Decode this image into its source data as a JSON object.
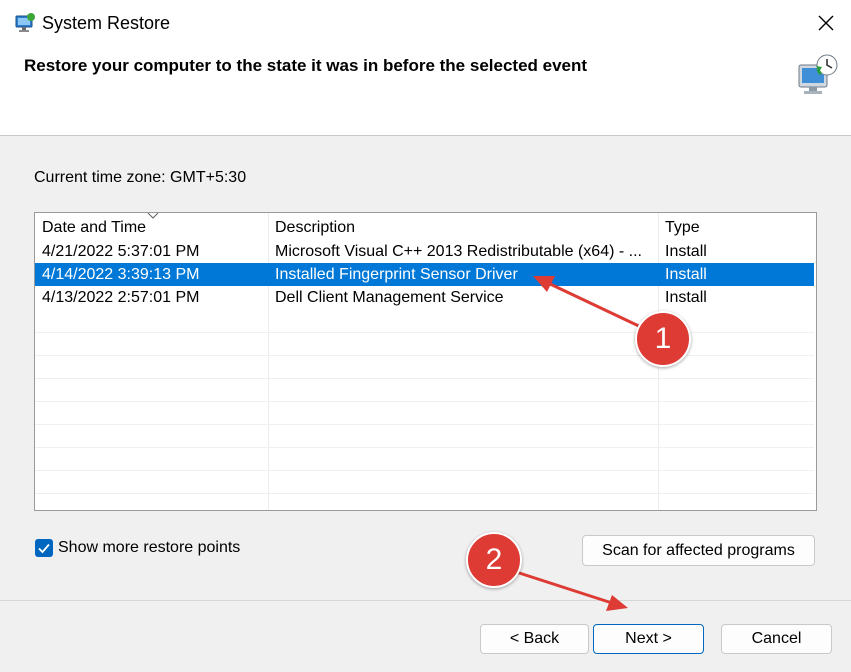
{
  "window": {
    "title": "System Restore",
    "close_icon": "close-icon"
  },
  "header": {
    "heading": "Restore your computer to the state it was in before the selected event"
  },
  "timezone": {
    "label": "Current time zone: GMT+5:30"
  },
  "table": {
    "columns": [
      "Date and Time",
      "Description",
      "Type"
    ],
    "rows": [
      {
        "date": "4/21/2022 5:37:01 PM",
        "description": "Microsoft Visual C++ 2013 Redistributable (x64) - ...",
        "type": "Install"
      },
      {
        "date": "4/14/2022 3:39:13 PM",
        "description": "Installed Fingerprint Sensor Driver",
        "type": "Install"
      },
      {
        "date": "4/13/2022 2:57:01 PM",
        "description": "Dell Client Management Service",
        "type": "Install"
      }
    ],
    "selected_row": 1
  },
  "options": {
    "show_more_label": "Show more restore points",
    "show_more_checked": true
  },
  "buttons": {
    "scan": "Scan for affected programs",
    "back": "< Back",
    "next": "Next >",
    "cancel": "Cancel"
  },
  "annotations": {
    "badge1": "1",
    "badge2": "2"
  },
  "colors": {
    "selection": "#0078d7",
    "annotation": "#dd3b34",
    "checkbox": "#0067c0"
  }
}
